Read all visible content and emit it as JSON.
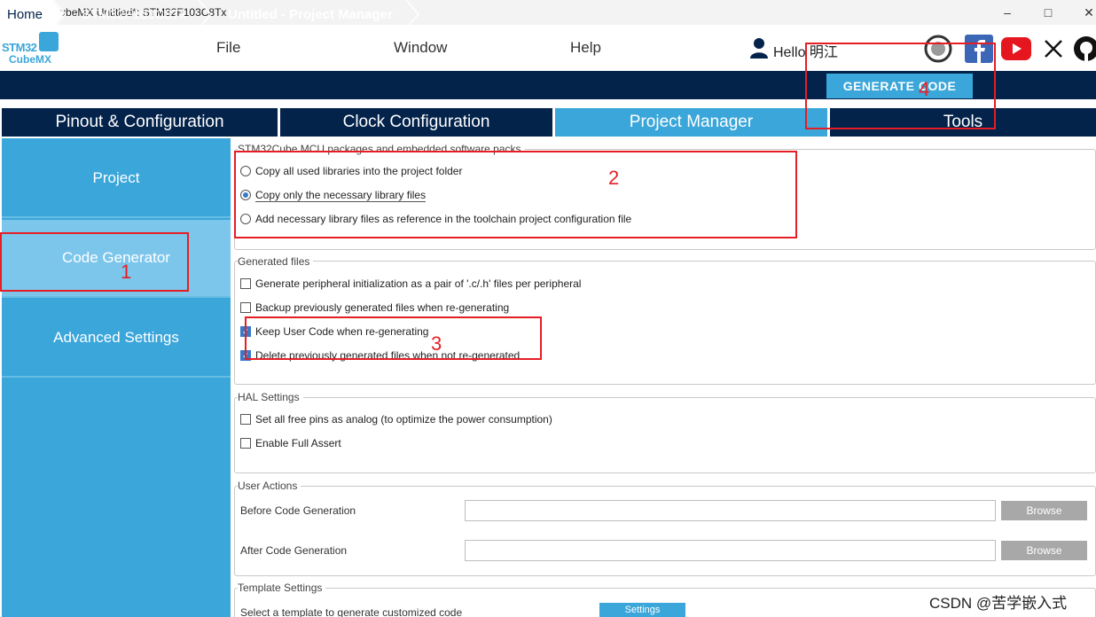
{
  "window": {
    "app_icon": "MX",
    "title": "STM32CubeMX Untitled*: STM32F103C8Tx",
    "controls": [
      "–",
      "□",
      "✕"
    ]
  },
  "logo": {
    "line1": "STM32",
    "line2": "CubeMX"
  },
  "menu": {
    "file": "File",
    "window": "Window",
    "help": "Help",
    "hello": "Hello 明江"
  },
  "social_icons": [
    "st-community-icon",
    "facebook-icon",
    "youtube-icon",
    "x-icon",
    "github-icon"
  ],
  "breadcrumb": {
    "home": "Home",
    "mcu": "STM32F103C8Tx",
    "page": "Untitled - Project Manager"
  },
  "generate_button": "GENERATE CODE",
  "tabs": {
    "pinout": "Pinout & Configuration",
    "clock": "Clock Configuration",
    "project_manager": "Project Manager",
    "tools": "Tools"
  },
  "sidebar": {
    "project": "Project",
    "code_generator": "Code Generator",
    "advanced": "Advanced Settings"
  },
  "packs": {
    "title": "STM32Cube MCU packages and embedded software packs",
    "opt1": "Copy all used libraries into the project folder",
    "opt2": "Copy only the necessary library files",
    "opt3": "Add necessary library files as reference in the toolchain project configuration file"
  },
  "generated": {
    "title": "Generated files",
    "opt1": "Generate peripheral initialization as a pair of '.c/.h' files per peripheral",
    "opt2": "Backup previously generated files when re-generating",
    "opt3": "Keep User Code when re-generating",
    "opt4": "Delete previously generated files when not re-generated"
  },
  "hal": {
    "title": "HAL Settings",
    "opt1": "Set all free pins as analog (to optimize the power consumption)",
    "opt2": "Enable Full Assert"
  },
  "user_actions": {
    "title": "User Actions",
    "before": "Before Code Generation",
    "after": "After Code Generation",
    "browse": "Browse"
  },
  "template": {
    "title": "Template Settings",
    "desc": "Select a template to generate customized code",
    "settings": "Settings"
  },
  "annotations": [
    "1",
    "2",
    "3",
    "4"
  ],
  "watermark": "CSDN @苦学嵌入式",
  "colors": {
    "navy": "#03234b",
    "accent": "#3aa6da",
    "annotation": "#e51e25"
  }
}
